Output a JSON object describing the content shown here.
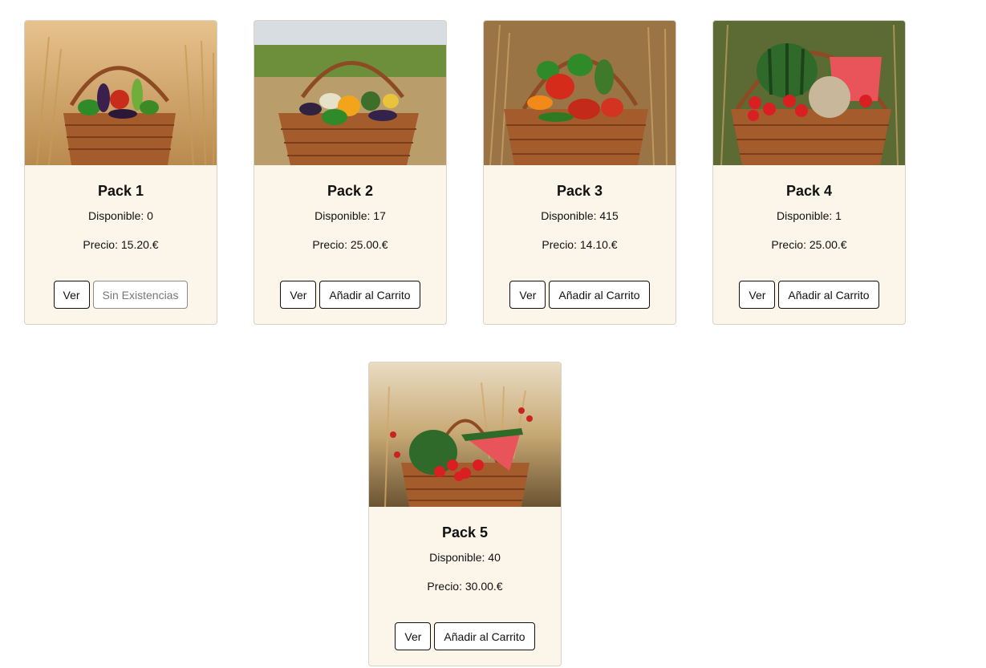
{
  "labels": {
    "view_button": "Ver",
    "add_to_cart_button": "Añadir al Carrito",
    "out_of_stock_button": "Sin Existencias"
  },
  "packs": [
    {
      "name": "Pack 1",
      "stock": "Disponible: 0",
      "price": "Precio: 15.20.€",
      "action": "Sin Existencias",
      "in_stock": false
    },
    {
      "name": "Pack 2",
      "stock": "Disponible: 17",
      "price": "Precio: 25.00.€",
      "action": "Añadir al Carrito",
      "in_stock": true
    },
    {
      "name": "Pack 3",
      "stock": "Disponible: 415",
      "price": "Precio: 14.10.€",
      "action": "Añadir al Carrito",
      "in_stock": true
    },
    {
      "name": "Pack 4",
      "stock": "Disponible: 1",
      "price": "Precio: 25.00.€",
      "action": "Añadir al Carrito",
      "in_stock": true
    },
    {
      "name": "Pack 5",
      "stock": "Disponible: 40",
      "price": "Precio: 30.00.€",
      "action": "Añadir al Carrito",
      "in_stock": true
    }
  ],
  "colors": {
    "card_background": "#fbf6e9",
    "card_border": "#d8d3c6",
    "button_border": "#111111",
    "disabled_border": "#8c8c8c"
  }
}
